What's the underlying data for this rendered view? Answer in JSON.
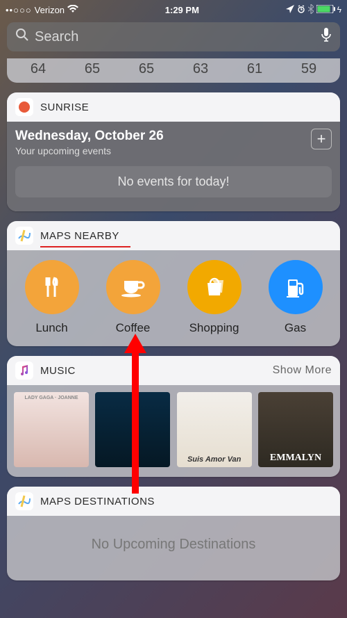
{
  "status": {
    "signal_dots": "••○○○",
    "carrier": "Verizon",
    "time": "1:29 PM"
  },
  "search": {
    "placeholder": "Search"
  },
  "weather": {
    "temps": [
      "64",
      "65",
      "65",
      "63",
      "61",
      "59"
    ]
  },
  "sunrise": {
    "title": "SUNRISE",
    "date": "Wednesday, October 26",
    "sub": "Your upcoming events",
    "empty": "No events for today!"
  },
  "maps_nearby": {
    "title": "MAPS NEARBY",
    "items": [
      {
        "label": "Lunch",
        "color": "orange"
      },
      {
        "label": "Coffee",
        "color": "orange"
      },
      {
        "label": "Shopping",
        "color": "yellow"
      },
      {
        "label": "Gas",
        "color": "blue"
      }
    ]
  },
  "music": {
    "title": "MUSIC",
    "show_more": "Show More",
    "albums": [
      "LADY GAGA · JOANNE",
      "",
      "Suis Amor Van",
      "EMMALYN"
    ]
  },
  "maps_dest": {
    "title": "MAPS DESTINATIONS",
    "empty": "No Upcoming Destinations"
  }
}
